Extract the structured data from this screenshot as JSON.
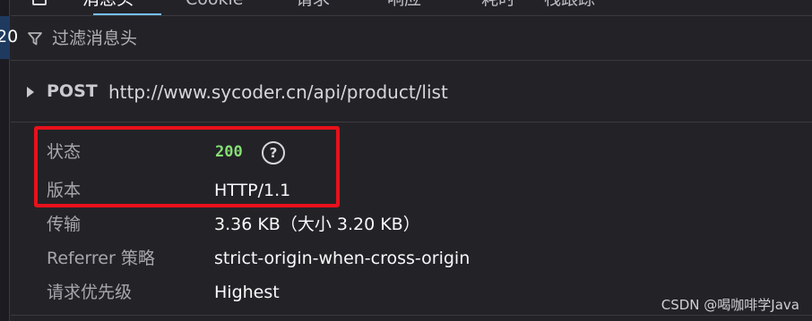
{
  "tabs": [
    {
      "label": "消息头",
      "active": true
    },
    {
      "label": "Cookie",
      "active": false
    },
    {
      "label": "请求",
      "active": false
    },
    {
      "label": "响应",
      "active": false
    },
    {
      "label": "耗时",
      "active": false
    },
    {
      "label": "栈跟踪",
      "active": false
    }
  ],
  "left_partial_text": "20",
  "filter": {
    "placeholder": "过滤消息头",
    "value": ""
  },
  "request": {
    "method": "POST",
    "url": "http://www.sycoder.cn/api/product/list"
  },
  "details": {
    "status": {
      "label": "状态",
      "value": "200",
      "help": "?"
    },
    "version": {
      "label": "版本",
      "value": "HTTP/1.1"
    },
    "transfer": {
      "label": "传输",
      "value": "3.36 KB（大小 3.20 KB）"
    },
    "referrer": {
      "label": "Referrer 策略",
      "value": "strict-origin-when-cross-origin"
    },
    "priority": {
      "label": "请求优先级",
      "value": "Highest"
    }
  },
  "watermark": "CSDN @喝咖啡学Java",
  "colors": {
    "background": "#232327",
    "status_ok": "#86de74",
    "highlight": "#e8111b",
    "tab_active": "#75bfff"
  }
}
